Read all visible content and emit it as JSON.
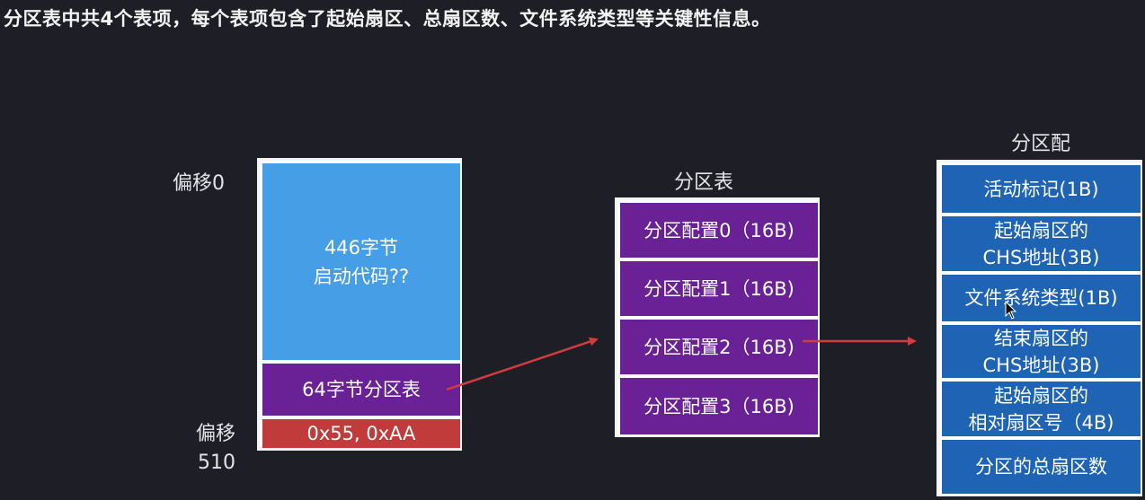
{
  "caption": "分区表中共4个表项，每个表项包含了起始扇区、总扇区数、文件系统类型等关键性信息。",
  "mbr": {
    "offset_top": "偏移0",
    "offset_bottom": "偏移\n510",
    "boot_code": "446字节\n启动代码??",
    "partition_table": "64字节分区表",
    "signature": "0x55, 0xAA"
  },
  "partition_table": {
    "title": "分区表",
    "entries": [
      "分区配置0（16B)",
      "分区配置1（16B)",
      "分区配置2（16B)",
      "分区配置3（16B)"
    ]
  },
  "partition_config": {
    "title": "分区配\n置",
    "fields": [
      "活动标记(1B)",
      "起始扇区的\nCHS地址(3B)",
      "文件系统类型(1B)",
      "结束扇区的\nCHS地址(3B)",
      "起始扇区的\n相对扇区号（4B)",
      "分区的总扇区数"
    ]
  },
  "colors": {
    "background": "#1e1f26",
    "boot_code": "#459ee6",
    "partition": "#6a2195",
    "signature": "#c23b3b",
    "config_field": "#1e63b4",
    "arrow": "#d23c3c"
  }
}
